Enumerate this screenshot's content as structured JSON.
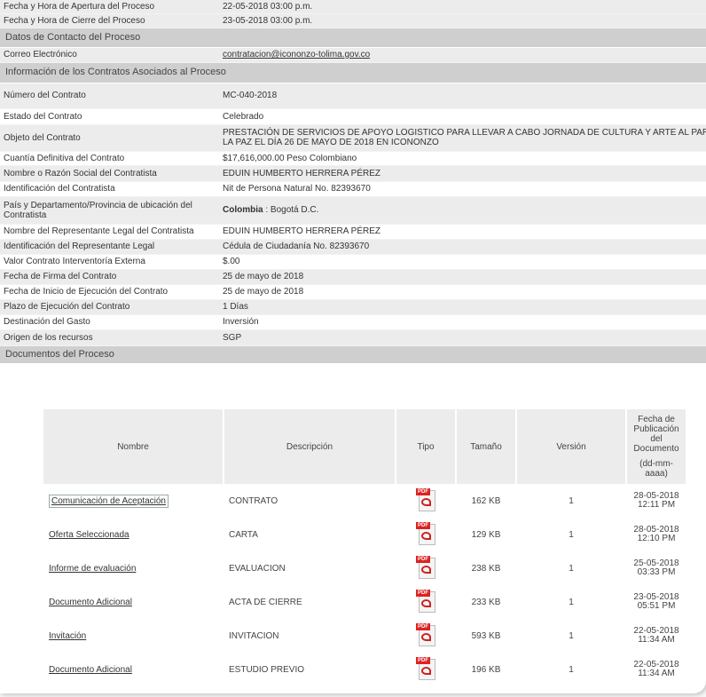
{
  "rows": [
    {
      "label": "Fecha y Hora de Apertura del Proceso",
      "value": "22-05-2018 03:00 p.m."
    },
    {
      "label": "Fecha y Hora de Cierre del Proceso",
      "value": "23-05-2018 03:00 p.m."
    }
  ],
  "sections": {
    "contacto": "Datos de Contacto del Proceso",
    "contratos": "Información de los Contratos Asociados al Proceso",
    "documentos": "Documentos del Proceso"
  },
  "contacto": {
    "label": "Correo Electrónico",
    "value": "contratacion@icononzo-tolima.gov.co"
  },
  "contrato": [
    {
      "label": "Número del Contrato",
      "value": "MC-040-2018"
    },
    {
      "label": "Estado del Contrato",
      "value": "Celebrado"
    },
    {
      "label": "Objeto del Contrato",
      "value": "PRESTACIÓN DE SERVICIOS DE APOYO LOGISTICO PARA LLEVAR A CABO JORNADA DE CULTURA Y ARTE AL PARQUE PARA LA PAZ EL DÍA 26 DE MAYO DE 2018 EN ICONONZO"
    },
    {
      "label": "Cuantía Definitiva del Contrato",
      "value": "$17,616,000.00 Peso Colombiano"
    },
    {
      "label": "Nombre o Razón Social del Contratista",
      "value": "EDUIN HUMBERTO HERRERA PÉREZ"
    },
    {
      "label": "Identificación del Contratista",
      "value": "Nit de Persona Natural No. 82393670"
    },
    {
      "label": "País y Departamento/Provincia de ubicación del Contratista",
      "value_bold": "Colombia",
      "value": " : Bogotá D.C."
    },
    {
      "label": "Nombre del Representante Legal del Contratista",
      "value": "EDUIN HUMBERTO HERRERA PÉREZ"
    },
    {
      "label": "Identificación del Representante Legal",
      "value": "Cédula de Ciudadanía No. 82393670"
    },
    {
      "label": "Valor Contrato Interventoría Externa",
      "value": "$.00"
    },
    {
      "label": "Fecha de Firma del Contrato",
      "value": "25 de mayo de 2018"
    },
    {
      "label": "Fecha de Inicio de Ejecución del Contrato",
      "value": "25 de mayo de 2018"
    },
    {
      "label": "Plazo de Ejecución del Contrato",
      "value": "1 Días"
    },
    {
      "label": "Destinación del Gasto",
      "value": "Inversión"
    },
    {
      "label": "Origen de los recursos",
      "value": "SGP"
    }
  ],
  "docs_headers": {
    "nombre": "Nombre",
    "descripcion": "Descripción",
    "tipo": "Tipo",
    "tamano": "Tamaño",
    "version": "Versión",
    "fecha": [
      "Fecha de",
      "Publicación",
      "del",
      "Documento",
      "(dd-mm-",
      "aaaa)"
    ]
  },
  "docs": [
    {
      "nombre": "Comunicación de Aceptación",
      "descripcion": "CONTRATO",
      "tamano": "162 KB",
      "version": "1",
      "fecha": "28-05-2018",
      "hora": "12:11 PM"
    },
    {
      "nombre": "Oferta Seleccionada",
      "descripcion": "CARTA",
      "tamano": "129 KB",
      "version": "1",
      "fecha": "28-05-2018",
      "hora": "12:10 PM"
    },
    {
      "nombre": "Informe de evaluación",
      "descripcion": "EVALUACION",
      "tamano": "238 KB",
      "version": "1",
      "fecha": "25-05-2018",
      "hora": "03:33 PM"
    },
    {
      "nombre": "Documento Adicional",
      "descripcion": "ACTA DE CIERRE",
      "tamano": "233 KB",
      "version": "1",
      "fecha": "23-05-2018",
      "hora": "05:51 PM"
    },
    {
      "nombre": "Invitación",
      "descripcion": "INVITACION",
      "tamano": "593 KB",
      "version": "1",
      "fecha": "22-05-2018",
      "hora": "11:34 AM"
    },
    {
      "nombre": "Documento Adicional",
      "descripcion": "ESTUDIO PREVIO",
      "tamano": "196 KB",
      "version": "1",
      "fecha": "22-05-2018",
      "hora": "11:34 AM"
    }
  ],
  "icons": {
    "pdf": "pdf-file-icon"
  },
  "pdf_badge": "PDF"
}
